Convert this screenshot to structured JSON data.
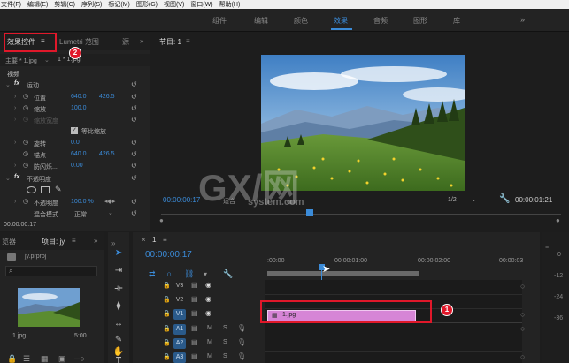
{
  "menubar": {
    "items": [
      "文件(F)",
      "编辑(E)",
      "剪辑(C)",
      "序列(S)",
      "标记(M)",
      "图形(G)",
      "视图(V)",
      "窗口(W)",
      "帮助(H)"
    ]
  },
  "workspace": {
    "tabs": [
      "组件",
      "编辑",
      "颜色",
      "效果",
      "音频",
      "图形",
      "库"
    ],
    "active": "效果",
    "more": "»"
  },
  "effect_controls": {
    "tabs": [
      "效果控件",
      "Lumetri 范围",
      "源"
    ],
    "menu_glyph": "≡",
    "more": "»",
    "source_clip": "主要 * 1.jpg",
    "sequence_clip": "1 * 1.jpg",
    "video_header": "视频",
    "motion_label": "运动",
    "opacity_label": "不透明度",
    "properties": [
      {
        "name": "位置",
        "v1": "640.0",
        "v2": "426.5"
      },
      {
        "name": "缩放",
        "v1": "100.0",
        "v2": ""
      },
      {
        "name": "缩放宽度",
        "v1": "",
        "v2": ""
      },
      {
        "name": "旋转",
        "v1": "0.0",
        "v2": ""
      },
      {
        "name": "锚点",
        "v1": "640.0",
        "v2": "426.5"
      },
      {
        "name": "防闪烁...",
        "v1": "0.00",
        "v2": ""
      }
    ],
    "uniform_scale": "等比缩放",
    "opacity_value": "100.0 %",
    "opacity_prop": "不透明度",
    "blend_label": "混合模式",
    "blend_value": "正常",
    "timecode": "00:00:00:17"
  },
  "program": {
    "title": "节目: 1",
    "menu_glyph": "≡",
    "timecode": "00:00:00:17",
    "fit": "适合",
    "zoom": "1/2",
    "duration": "00:00:01:21"
  },
  "watermark": {
    "text1": "GX/网",
    "text2": "system.com"
  },
  "project": {
    "tab_browser": "览器",
    "tab_project": "项目: jy",
    "menu_glyph": "≡",
    "more": "»",
    "file": "jy.prproj",
    "clip_name": "1.jpg",
    "clip_dur": "5:00"
  },
  "timeline": {
    "seq_name": "1",
    "menu_glyph": "≡",
    "close": "×",
    "timecode": "00:00:00:17",
    "ruler": [
      ":00:00",
      "00:00:01:00",
      "00:00:02:00",
      "00:00:03"
    ],
    "clip_label": "1.jpg",
    "tracks": [
      {
        "name": "V3"
      },
      {
        "name": "V2"
      },
      {
        "name": "V1"
      },
      {
        "name": "A1"
      },
      {
        "name": "A2"
      },
      {
        "name": "A3"
      }
    ],
    "mute": "M",
    "solo": "S"
  },
  "meter": {
    "labels": [
      "0",
      "-12",
      "-24",
      "-36"
    ]
  },
  "annotations": {
    "badge1": "1",
    "badge2": "2"
  },
  "colors": {
    "accent": "#3b8bd8",
    "clip": "#d685d6",
    "annotation": "#e0182a"
  }
}
